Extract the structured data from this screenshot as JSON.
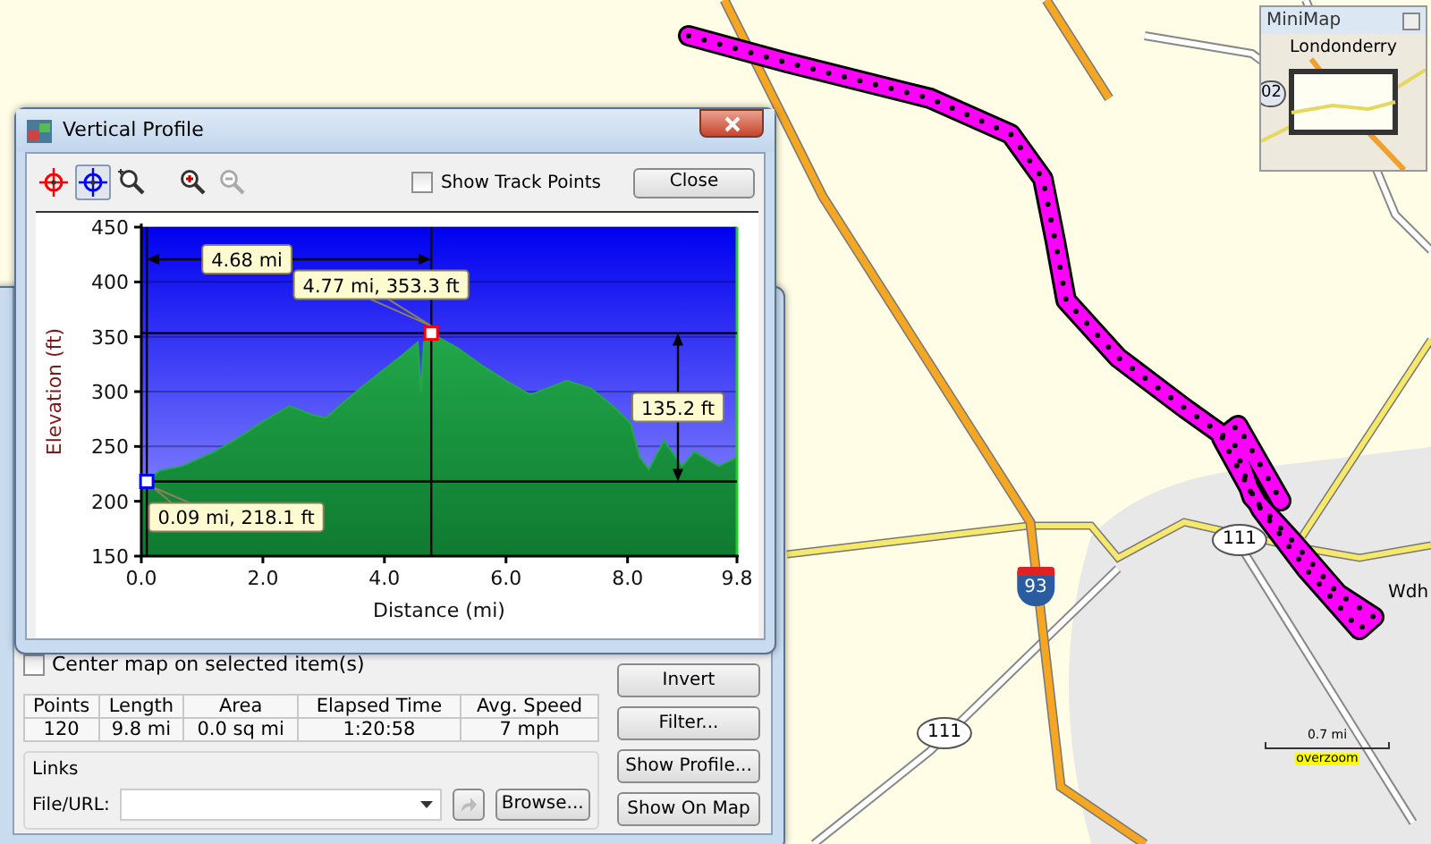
{
  "map": {
    "labels": [
      {
        "kind": "shield",
        "text": "111"
      },
      {
        "kind": "shield",
        "text": "111"
      },
      {
        "kind": "interstate",
        "text": "93"
      },
      {
        "kind": "town",
        "text": "Wdh"
      }
    ],
    "scale": {
      "distance": "0.7 mi",
      "note": "overzoom"
    }
  },
  "minimap": {
    "title": "MiniMap",
    "place": "Londonderry",
    "shield": "02"
  },
  "properties_panel": {
    "center_map": {
      "label": "Center map on selected item(s)",
      "checked": false
    },
    "stats": {
      "columns": [
        "Points",
        "Length",
        "Area",
        "Elapsed Time",
        "Avg. Speed"
      ],
      "values": [
        "120",
        "9.8 mi",
        "0.0 sq mi",
        "1:20:58",
        "7 mph"
      ]
    },
    "links": {
      "title": "Links",
      "field_label": "File/URL:",
      "open_disabled": true,
      "browse_button": "Browse..."
    },
    "buttons": [
      "Invert",
      "Filter...",
      "Show Profile...",
      "Show On Map"
    ]
  },
  "profile_window": {
    "title": "Vertical Profile",
    "tools": [
      {
        "kind": "crosshair",
        "color": "#ff0000",
        "selected": false,
        "disabled": false
      },
      {
        "kind": "crosshair",
        "color": "#0000ff",
        "selected": true,
        "disabled": false
      },
      {
        "kind": "zoombox",
        "selected": false,
        "disabled": false
      },
      {
        "kind": "zoomin",
        "selected": false,
        "disabled": false
      },
      {
        "kind": "zoomout",
        "selected": false,
        "disabled": true
      }
    ],
    "show_track_points": {
      "label": "Show Track Points",
      "checked": false
    },
    "close_button": "Close",
    "chart_data": {
      "type": "area",
      "xlabel": "Distance   (mi)",
      "ylabel": "Elevation (ft)",
      "x": [
        0,
        0.09,
        0.3,
        0.67,
        1.2,
        1.6,
        1.95,
        2.44,
        2.8,
        3.03,
        3.6,
        4.2,
        4.55,
        4.6,
        4.65,
        4.77,
        5.2,
        5.6,
        6.0,
        6.4,
        7.0,
        7.4,
        7.8,
        8.05,
        8.2,
        8.35,
        8.6,
        8.9,
        9.1,
        9.5,
        9.8
      ],
      "series": [
        {
          "color": "#22a84a",
          "values": [
            215,
            218,
            228,
            232,
            245,
            258,
            271,
            287,
            279,
            276,
            303,
            329,
            345,
            300,
            345,
            353,
            340,
            324,
            310,
            297,
            310,
            303,
            285,
            271,
            240,
            229,
            255,
            232,
            245,
            232,
            240
          ]
        }
      ],
      "xlim": [
        0,
        9.8
      ],
      "ylim": [
        150,
        450
      ],
      "xticks": [
        {
          "value": 0,
          "label": "0.0"
        },
        {
          "value": 2,
          "label": "2.0"
        },
        {
          "value": 4,
          "label": "4.0"
        },
        {
          "value": 6,
          "label": "6.0"
        },
        {
          "value": 8,
          "label": "8.0"
        },
        {
          "value": 9.8,
          "label": "9.8"
        }
      ],
      "yticks": [
        150,
        200,
        250,
        300,
        350,
        400,
        450
      ],
      "grid": true,
      "ref_lines": [
        {
          "axis": "x",
          "value": 0.09
        },
        {
          "axis": "x",
          "value": 4.77
        },
        {
          "axis": "y",
          "value": 218.1
        },
        {
          "axis": "y",
          "value": 353.3
        }
      ],
      "annotations": [
        "4.68 mi",
        {
          "text": "4.77 mi, 353.3 ft",
          "x": 4.77,
          "y": 353.3
        },
        {
          "text": "0.09 mi, 218.1 ft",
          "x": 0.09,
          "y": 218.1
        },
        "135.2 ft"
      ]
    }
  }
}
